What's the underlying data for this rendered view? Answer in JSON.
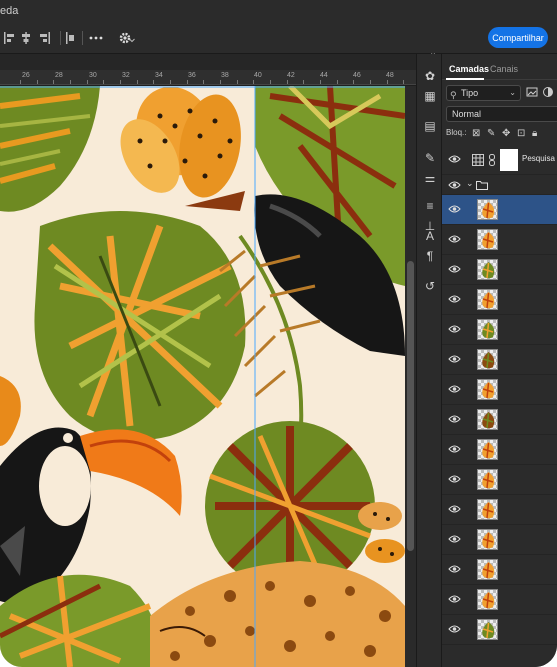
{
  "app": {
    "title_fragment": "eda"
  },
  "options_bar": {
    "share_label": "Compartilhar"
  },
  "ruler": {
    "labels": [
      "26",
      "28",
      "30",
      "32",
      "34",
      "36",
      "38",
      "40",
      "42",
      "44",
      "46",
      "48"
    ]
  },
  "layers_panel": {
    "tabs": [
      {
        "label": "Camadas",
        "active": true
      },
      {
        "label": "Canais",
        "active": false
      }
    ],
    "filter": {
      "value": "Tipo"
    },
    "blend_mode": "Normal",
    "lock_label": "Bloq.:",
    "fill_layer_name": "Pesquisa d",
    "layer_thumbnails": [
      "leaf-orange",
      "leaf-orange",
      "leaf-green",
      "leaf-orange",
      "leaf-green",
      "leaf-brown",
      "leaf-orange",
      "leaf-brown",
      "leaf-orange",
      "leaf-orange",
      "leaf-orange",
      "leaf-orange",
      "leaf-orange",
      "leaf-orange",
      "leaf-green"
    ]
  },
  "colors": {
    "accent": "#1473e6",
    "selected_row": "#2d5388",
    "panel_bg": "#2b2b2b",
    "canvas_bg": "#f8ebd8"
  }
}
